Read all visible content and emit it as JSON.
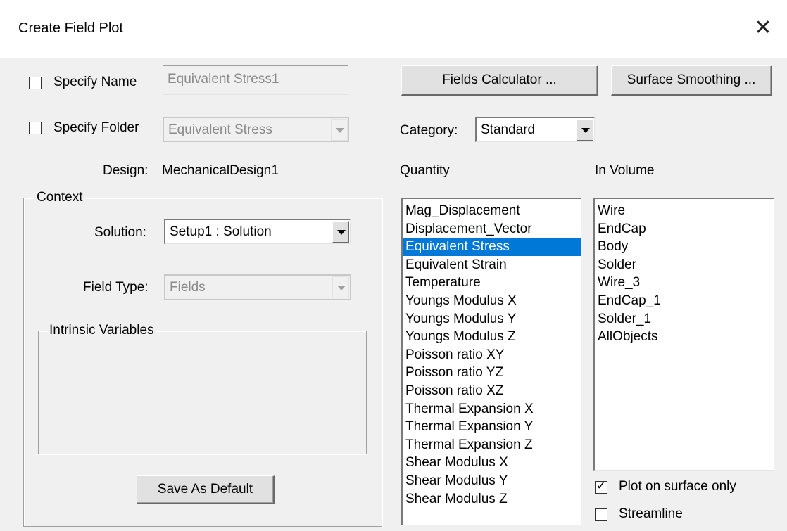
{
  "window": {
    "title": "Create Field Plot"
  },
  "specify_name": {
    "label": "Specify Name",
    "checked": false,
    "value": "Equivalent Stress1"
  },
  "specify_folder": {
    "label": "Specify Folder",
    "checked": false,
    "value": "Equivalent Stress"
  },
  "buttons": {
    "fields_calculator": "Fields Calculator ...",
    "surface_smoothing": "Surface Smoothing ...",
    "save_default": "Save As Default"
  },
  "category": {
    "label": "Category:",
    "value": "Standard"
  },
  "design": {
    "label": "Design:",
    "value": "MechanicalDesign1"
  },
  "context": {
    "title": "Context",
    "solution_label": "Solution:",
    "solution_value": "Setup1 : Solution",
    "field_type_label": "Field Type:",
    "field_type_value": "Fields",
    "intrinsic_title": "Intrinsic Variables"
  },
  "quantity": {
    "label": "Quantity",
    "selected": "Equivalent Stress",
    "items": [
      "Mag_Displacement",
      "Displacement_Vector",
      "Equivalent Stress",
      "Equivalent Strain",
      "Temperature",
      "Youngs Modulus X",
      "Youngs Modulus Y",
      "Youngs Modulus Z",
      "Poisson ratio XY",
      "Poisson ratio YZ",
      "Poisson ratio XZ",
      "Thermal Expansion X",
      "Thermal Expansion Y",
      "Thermal Expansion Z",
      "Shear Modulus X",
      "Shear Modulus Y",
      "Shear Modulus Z"
    ]
  },
  "in_volume": {
    "label": "In Volume",
    "items": [
      "Wire",
      "EndCap",
      "Body",
      "Solder",
      "Wire_3",
      "EndCap_1",
      "Solder_1",
      "AllObjects"
    ]
  },
  "plot_on_surface_only": {
    "label": "Plot on surface only",
    "checked": true
  },
  "streamline": {
    "label": "Streamline",
    "checked": false
  },
  "colors": {
    "selection": "#0078d7",
    "dialog_bg": "#f0f0f0"
  }
}
